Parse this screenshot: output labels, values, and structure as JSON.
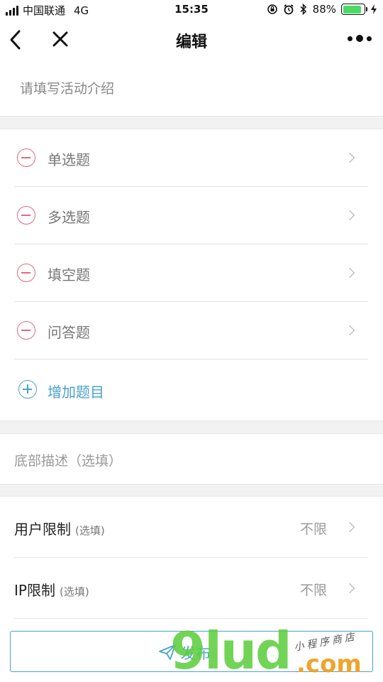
{
  "status_bar": {
    "carrier": "中国联通",
    "network": "4G",
    "time": "15:35",
    "battery_percent": "88%",
    "battery_level": 0.88
  },
  "nav": {
    "title": "编辑"
  },
  "intro": {
    "placeholder": "请填写活动介绍"
  },
  "questions": {
    "items": [
      {
        "label": "单选题"
      },
      {
        "label": "多选题"
      },
      {
        "label": "填空题"
      },
      {
        "label": "问答题"
      }
    ],
    "add_label": "增加题目"
  },
  "footer_desc": {
    "placeholder": "底部描述（选填）"
  },
  "limits": {
    "items": [
      {
        "label": "用户限制",
        "sub": "(选填)",
        "value": "不限"
      },
      {
        "label": "IP限制",
        "sub": "(选填)",
        "value": "不限"
      }
    ]
  },
  "publish": {
    "label": "发布"
  },
  "watermark": {
    "main": "9lud",
    "sub": ".com",
    "tag": "小程序商店"
  },
  "colors": {
    "accent": "#4aa3c9",
    "remove": "#e06a7f",
    "battery": "#4cd964"
  }
}
